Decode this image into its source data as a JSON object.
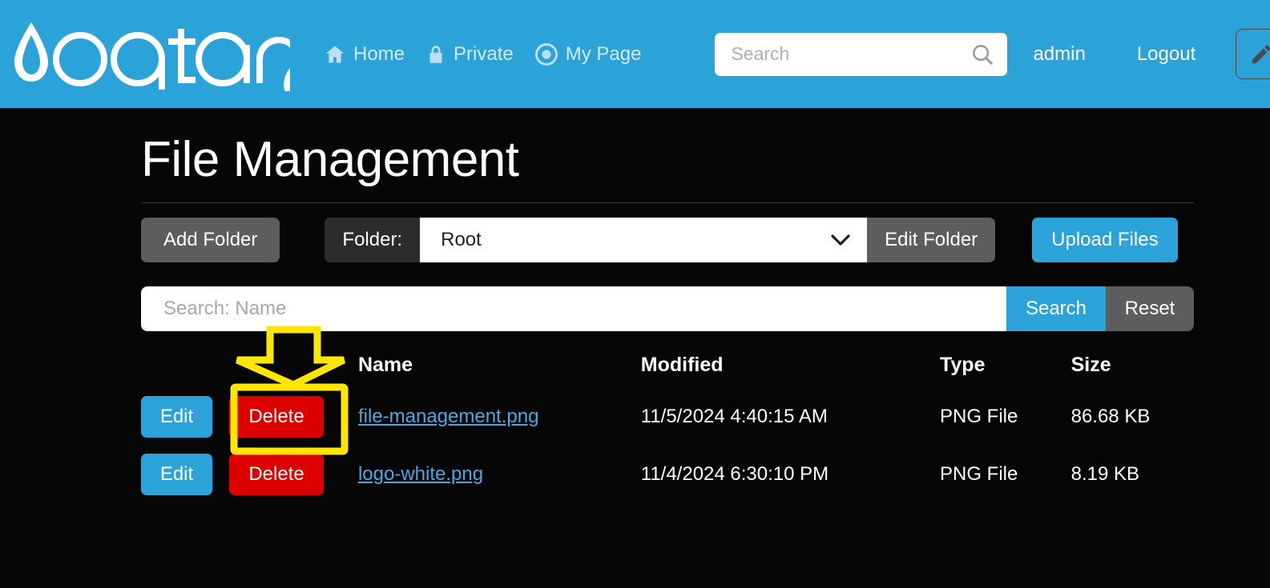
{
  "header": {
    "brand": "oqtane",
    "nav": [
      {
        "label": "Home",
        "icon": "home-icon"
      },
      {
        "label": "Private",
        "icon": "lock-icon"
      },
      {
        "label": "My Page",
        "icon": "target-icon"
      }
    ],
    "search": {
      "placeholder": "Search",
      "value": "",
      "icon": "search-icon"
    },
    "user": "admin",
    "logout": "Logout",
    "edit_toggle_icon": "pencil-icon",
    "background_color": "#2ba3d8"
  },
  "page": {
    "title": "File Management"
  },
  "toolbar": {
    "add_folder": "Add Folder",
    "folder_label": "Folder:",
    "folder_value": "Root",
    "folder_options": [
      "Root"
    ],
    "edit_folder": "Edit Folder",
    "upload_files": "Upload Files"
  },
  "filter": {
    "placeholder": "Search: Name",
    "value": "",
    "search_button": "Search",
    "reset_button": "Reset"
  },
  "table": {
    "columns": [
      "",
      "Name",
      "Modified",
      "Type",
      "Size"
    ],
    "actions": {
      "edit": "Edit",
      "delete": "Delete"
    },
    "rows": [
      {
        "name": "file-management.png",
        "modified": "11/5/2024 4:40:15 AM",
        "type": "PNG File",
        "size": "86.68 KB",
        "highlighted": true
      },
      {
        "name": "logo-white.png",
        "modified": "11/4/2024 6:30:10 PM",
        "type": "PNG File",
        "size": "8.19 KB",
        "highlighted": false
      }
    ]
  },
  "annotation": {
    "type": "arrow-and-highlight",
    "color": "#ffe600",
    "target": "delete-button-row-1"
  },
  "colors": {
    "accent": "#2ba3d8",
    "danger": "#dd0000",
    "secondary": "#5d5d5d",
    "background": "#060606",
    "link": "#4aa8e0",
    "annotation": "#ffe600"
  }
}
